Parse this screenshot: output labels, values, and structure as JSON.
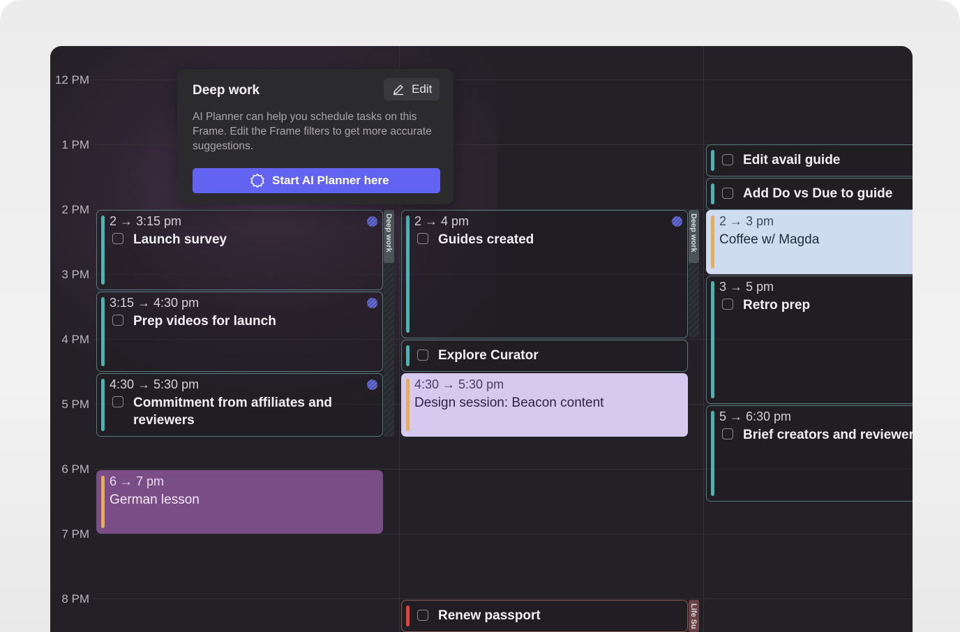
{
  "time_labels": [
    "12 PM",
    "1 PM",
    "2 PM",
    "3 PM",
    "4 PM",
    "5 PM",
    "6 PM",
    "7 PM",
    "8 PM"
  ],
  "frames": {
    "deep_work": "Deep work",
    "life": "Life Su"
  },
  "popover": {
    "title": "Deep work",
    "edit_label": "Edit",
    "description": "AI Planner can help you schedule tasks on this Frame. Edit the Frame filters to get more accurate suggestions.",
    "button_label": "Start AI Planner here"
  },
  "events": {
    "launch_survey": {
      "time": "2 → 3:15 pm",
      "title": "Launch survey"
    },
    "prep_videos": {
      "time": "3:15 → 4:30 pm",
      "title": "Prep videos for launch"
    },
    "commitment": {
      "time": "4:30 → 5:30 pm",
      "title": "Commitment from affiliates and reviewers"
    },
    "german": {
      "time": "6 → 7 pm",
      "title": "German lesson"
    },
    "guides": {
      "time": "2 → 4 pm",
      "title": "Guides created"
    },
    "explore": {
      "title": "Explore Curator"
    },
    "design": {
      "time": "4:30 → 5:30 pm",
      "title": "Design session: Beacon content"
    },
    "passport": {
      "title": "Renew passport"
    },
    "edit_avail": {
      "title": "Edit avail guide"
    },
    "do_vs_due": {
      "title": "Add Do vs Due to guide"
    },
    "coffee": {
      "time": "2 → 3 pm",
      "title": "Coffee w/ Magda"
    },
    "retro": {
      "time": "3 → 5 pm",
      "title": "Retro prep"
    },
    "brief": {
      "time": "5 → 6:30 pm",
      "title": "Brief creators and reviewers"
    }
  },
  "colors": {
    "background": "#232125",
    "task_bar": "#4fb3b3",
    "amber_bar": "#e6ae5c",
    "red_bar": "#e0443c",
    "lilac_event": "#d6c9ee",
    "blue_event": "#cfdcf0",
    "purple_event": "#7a4d86",
    "ai_button": "#6363f1"
  }
}
